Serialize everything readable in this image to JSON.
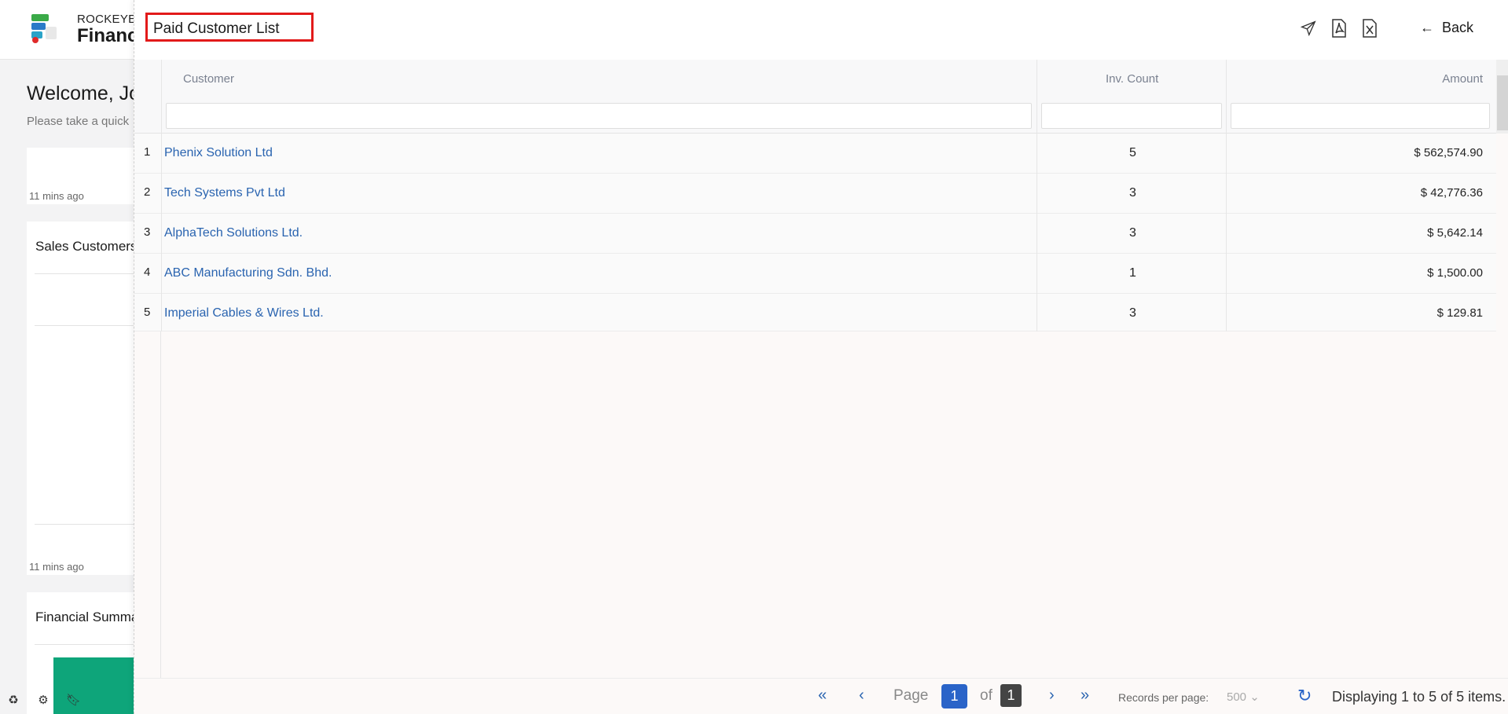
{
  "background": {
    "brand_small": "ROCKEYE",
    "brand_big": "Financ",
    "welcome": "Welcome, Jo",
    "welcome_sub": "Please take a quick",
    "card1": {
      "time": "11 mins ago"
    },
    "card2": {
      "title": "Sales Customers",
      "time": "11 mins ago"
    },
    "card3": {
      "title": "Financial Summary"
    },
    "tools": [
      "recycle-icon",
      "settings-icon",
      "bookmark-icon"
    ]
  },
  "panel": {
    "title": "Paid Customer List",
    "header_icons": [
      "send-icon",
      "pdf-export-icon",
      "excel-export-icon"
    ],
    "back_label": "Back"
  },
  "grid": {
    "columns": {
      "customer": "Customer",
      "count": "Inv. Count",
      "amount": "Amount"
    },
    "rows": [
      {
        "no": "1",
        "customer": "Phenix Solution Ltd",
        "count": "5",
        "amount": "$ 562,574.90"
      },
      {
        "no": "2",
        "customer": "Tech Systems Pvt Ltd",
        "count": "3",
        "amount": "$ 42,776.36"
      },
      {
        "no": "3",
        "customer": "AlphaTech Solutions Ltd.",
        "count": "3",
        "amount": "$ 5,642.14"
      },
      {
        "no": "4",
        "customer": "ABC Manufacturing Sdn. Bhd.",
        "count": "1",
        "amount": "$ 1,500.00"
      },
      {
        "no": "5",
        "customer": "Imperial Cables & Wires Ltd.",
        "count": "3",
        "amount": "$ 129.81"
      }
    ]
  },
  "pager": {
    "page_label": "Page",
    "current": "1",
    "of_label": "of",
    "total": "1",
    "records_label": "Records per page:",
    "records_value": "500",
    "display_text": "Displaying 1 to 5 of 5 items."
  },
  "colors": {
    "link": "#2a64b0",
    "accent": "#2a64c8",
    "title_border": "#e21a1a",
    "green": "#0ea57a"
  }
}
